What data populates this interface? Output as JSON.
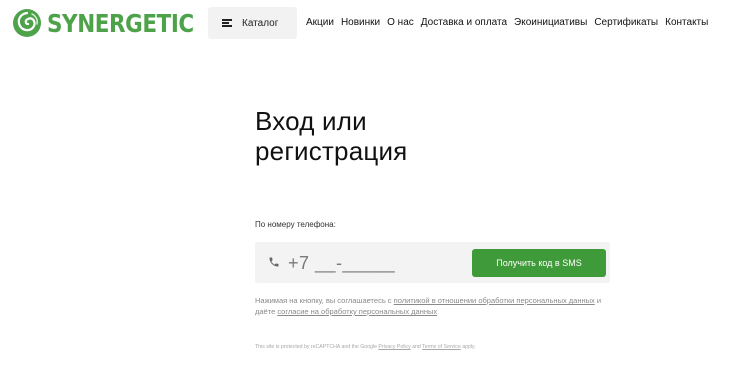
{
  "header": {
    "logo_text": "SYNERGETIC",
    "catalog_label": "Каталог",
    "nav": [
      "Акции",
      "Новинки",
      "О нас",
      "Доставка и оплата",
      "Экоинициативы",
      "Сертификаты",
      "Контакты"
    ]
  },
  "login": {
    "title_line1": "Вход или",
    "title_line2": "регистрация",
    "phone_label": "По номеру телефона:",
    "phone_placeholder": "+7 __-_____",
    "sms_button": "Получить код в SMS",
    "agree_prefix": "Нажимая на кнопку, вы соглашаетесь с ",
    "agree_link1": "политикой в отношении обработки персональных данных",
    "agree_middle": " и даёте ",
    "agree_link2": "согласие на обработку персональных данных"
  },
  "recaptcha": {
    "prefix": "This site is protected by reCAPTCHA and the Google ",
    "privacy": "Privacy Policy",
    "and": " and ",
    "terms": "Terms of Service",
    "suffix": " apply."
  },
  "colors": {
    "brand_green": "#4ea24a",
    "button_green": "#3f9a3a",
    "input_bg": "#f3f3f3"
  },
  "icons": {
    "logo": "leaf-spiral-logo-icon",
    "menu": "burger-menu-icon",
    "phone": "phone-handset-icon"
  }
}
